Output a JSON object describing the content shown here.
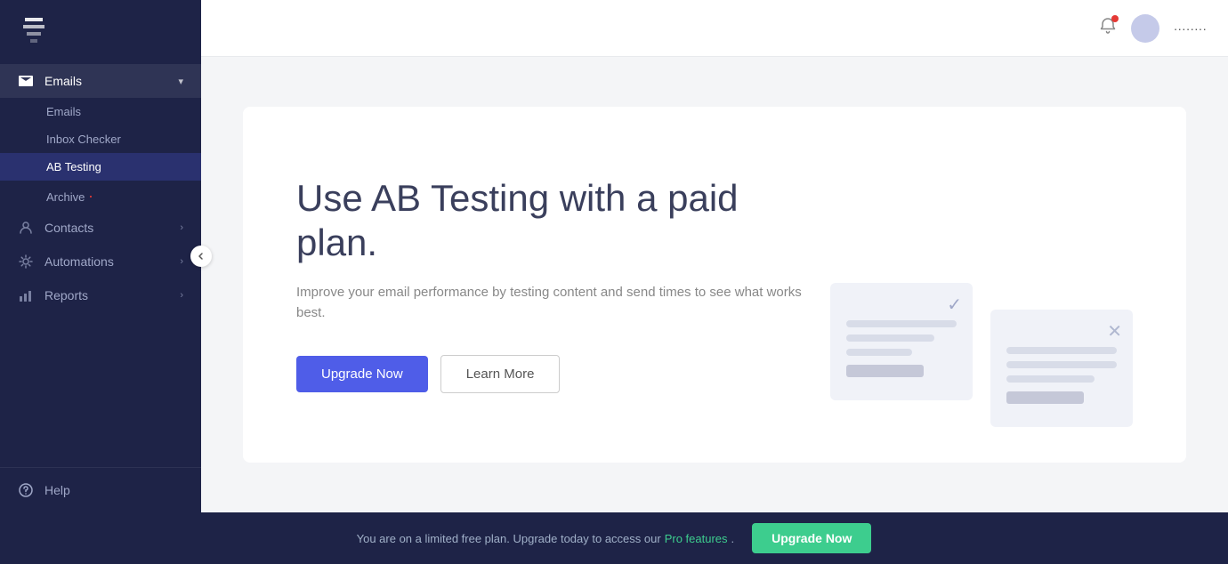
{
  "sidebar": {
    "logo_alt": "App Logo",
    "nav": [
      {
        "id": "emails",
        "label": "Emails",
        "icon": "email-icon",
        "has_chevron": true,
        "active": true,
        "sub_items": [
          {
            "id": "emails-sub",
            "label": "Emails",
            "active": false
          },
          {
            "id": "inbox-checker",
            "label": "Inbox Checker",
            "active": false
          },
          {
            "id": "ab-testing",
            "label": "AB Testing",
            "active": true
          },
          {
            "id": "archive",
            "label": "Archive",
            "active": false,
            "badge": "·"
          }
        ]
      },
      {
        "id": "contacts",
        "label": "Contacts",
        "icon": "contacts-icon",
        "has_chevron": true,
        "active": false,
        "sub_items": []
      },
      {
        "id": "automations",
        "label": "Automations",
        "icon": "automations-icon",
        "has_chevron": true,
        "active": false,
        "sub_items": []
      },
      {
        "id": "reports",
        "label": "Reports",
        "icon": "reports-icon",
        "has_chevron": true,
        "active": false,
        "sub_items": []
      }
    ],
    "help_label": "Help",
    "help_icon": "help-icon"
  },
  "topbar": {
    "notification_icon": "bell-icon",
    "avatar_alt": "User avatar",
    "username": "········"
  },
  "main": {
    "upgrade_title": "Use AB Testing with a paid plan.",
    "upgrade_desc": "Improve your email performance by testing content and send times to see what works best.",
    "upgrade_button": "Upgrade Now",
    "learn_more_button": "Learn More"
  },
  "bottom_bar": {
    "message": "You are on a limited free plan. Upgrade today to access our",
    "link_text": "Pro features",
    "period": ".",
    "upgrade_button": "Upgrade Now"
  },
  "colors": {
    "sidebar_bg": "#1e2347",
    "active_sidebar_item": "#3d45a0",
    "primary_button": "#4f5de8",
    "success_green": "#3dcd8e"
  }
}
